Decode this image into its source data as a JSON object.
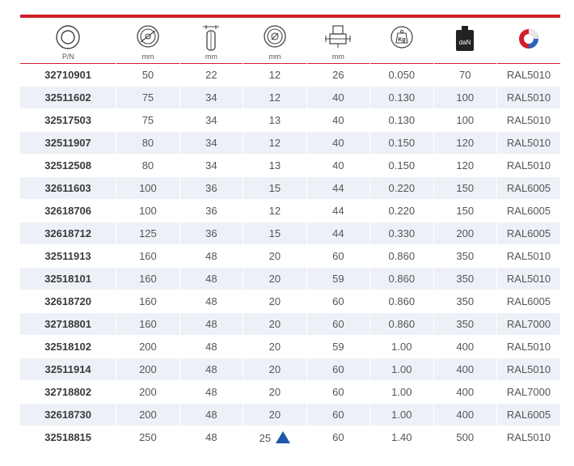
{
  "header": {
    "columns": [
      {
        "icon": "wheel-ring-icon",
        "unit": "P/N"
      },
      {
        "icon": "wheel-diameter-icon",
        "unit": "mm"
      },
      {
        "icon": "wheel-width-icon",
        "unit": "mm"
      },
      {
        "icon": "bore-diameter-icon",
        "unit": "mm"
      },
      {
        "icon": "hub-length-icon",
        "unit": "mm"
      },
      {
        "icon": "weight-kg-icon",
        "unit": "",
        "badge": "Kg"
      },
      {
        "icon": "load-capacity-icon",
        "unit": "",
        "badge": "daN"
      },
      {
        "icon": "color-ring-icon",
        "unit": ""
      }
    ]
  },
  "colors": {
    "accent_red": "#d01f2a",
    "stripe": "#edf1f7",
    "marker_blue": "#1f57a6"
  },
  "rows": [
    {
      "pn": "32710901",
      "d": "50",
      "w": "22",
      "bore": "12",
      "hub": "26",
      "kg": "0.050",
      "dan": "70",
      "ral": "RAL5010"
    },
    {
      "pn": "32511602",
      "d": "75",
      "w": "34",
      "bore": "12",
      "hub": "40",
      "kg": "0.130",
      "dan": "100",
      "ral": "RAL5010"
    },
    {
      "pn": "32517503",
      "d": "75",
      "w": "34",
      "bore": "13",
      "hub": "40",
      "kg": "0.130",
      "dan": "100",
      "ral": "RAL5010"
    },
    {
      "pn": "32511907",
      "d": "80",
      "w": "34",
      "bore": "12",
      "hub": "40",
      "kg": "0.150",
      "dan": "120",
      "ral": "RAL5010"
    },
    {
      "pn": "32512508",
      "d": "80",
      "w": "34",
      "bore": "13",
      "hub": "40",
      "kg": "0.150",
      "dan": "120",
      "ral": "RAL5010"
    },
    {
      "pn": "32611603",
      "d": "100",
      "w": "36",
      "bore": "15",
      "hub": "44",
      "kg": "0.220",
      "dan": "150",
      "ral": "RAL6005"
    },
    {
      "pn": "32618706",
      "d": "100",
      "w": "36",
      "bore": "12",
      "hub": "44",
      "kg": "0.220",
      "dan": "150",
      "ral": "RAL6005"
    },
    {
      "pn": "32618712",
      "d": "125",
      "w": "36",
      "bore": "15",
      "hub": "44",
      "kg": "0.330",
      "dan": "200",
      "ral": "RAL6005"
    },
    {
      "pn": "32511913",
      "d": "160",
      "w": "48",
      "bore": "20",
      "hub": "60",
      "kg": "0.860",
      "dan": "350",
      "ral": "RAL5010"
    },
    {
      "pn": "32518101",
      "d": "160",
      "w": "48",
      "bore": "20",
      "hub": "59",
      "kg": "0.860",
      "dan": "350",
      "ral": "RAL5010"
    },
    {
      "pn": "32618720",
      "d": "160",
      "w": "48",
      "bore": "20",
      "hub": "60",
      "kg": "0.860",
      "dan": "350",
      "ral": "RAL6005"
    },
    {
      "pn": "32718801",
      "d": "160",
      "w": "48",
      "bore": "20",
      "hub": "60",
      "kg": "0.860",
      "dan": "350",
      "ral": "RAL7000"
    },
    {
      "pn": "32518102",
      "d": "200",
      "w": "48",
      "bore": "20",
      "hub": "59",
      "kg": "1.00",
      "dan": "400",
      "ral": "RAL5010"
    },
    {
      "pn": "32511914",
      "d": "200",
      "w": "48",
      "bore": "20",
      "hub": "60",
      "kg": "1.00",
      "dan": "400",
      "ral": "RAL5010"
    },
    {
      "pn": "32718802",
      "d": "200",
      "w": "48",
      "bore": "20",
      "hub": "60",
      "kg": "1.00",
      "dan": "400",
      "ral": "RAL7000"
    },
    {
      "pn": "32618730",
      "d": "200",
      "w": "48",
      "bore": "20",
      "hub": "60",
      "kg": "1.00",
      "dan": "400",
      "ral": "RAL6005"
    },
    {
      "pn": "32518815",
      "d": "250",
      "w": "48",
      "bore": "25",
      "hub": "60",
      "kg": "1.40",
      "dan": "500",
      "ral": "RAL5010",
      "marker": "blue-triangle-icon"
    }
  ]
}
